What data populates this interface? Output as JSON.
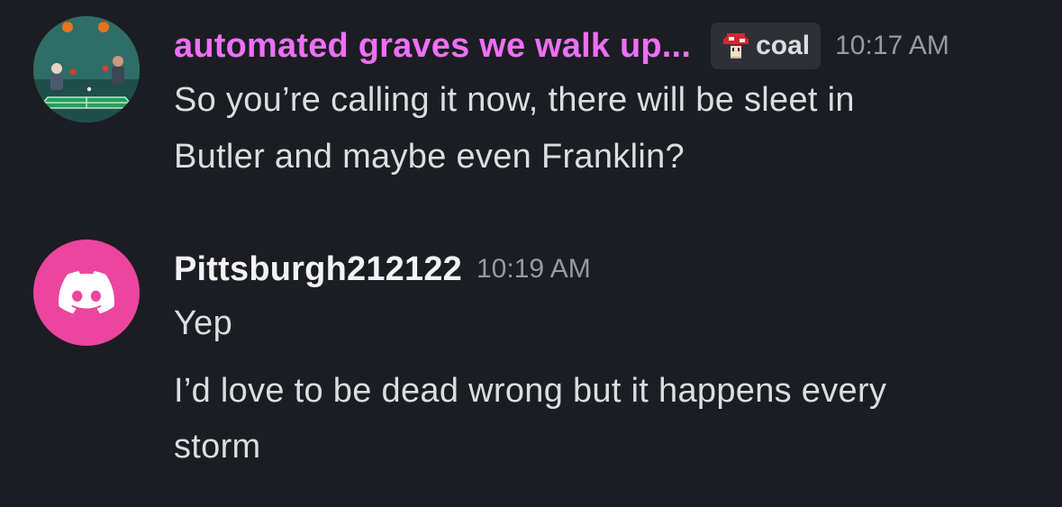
{
  "messages": [
    {
      "username": "automated graves we walk up...",
      "tag": {
        "label": "coal",
        "icon": "mushroom-icon"
      },
      "timestamp": "10:17 AM",
      "lines": [
        "So you’re calling it now, there will be sleet in",
        "Butler and maybe even Franklin?"
      ],
      "name_color": "#ee6ff8",
      "avatar": "ping-pong-avatar"
    },
    {
      "username": "Pittsburgh212122",
      "timestamp": "10:19 AM",
      "lines": [
        "Yep",
        "I’d love to be dead wrong but it happens every",
        "storm"
      ],
      "name_color": "#f2f3f5",
      "avatar": "discord-logo-avatar",
      "avatar_color": "#eb459f"
    }
  ],
  "colors": {
    "background": "#1c1d22",
    "text": "#dbdee1",
    "timestamp": "#949ba4"
  }
}
